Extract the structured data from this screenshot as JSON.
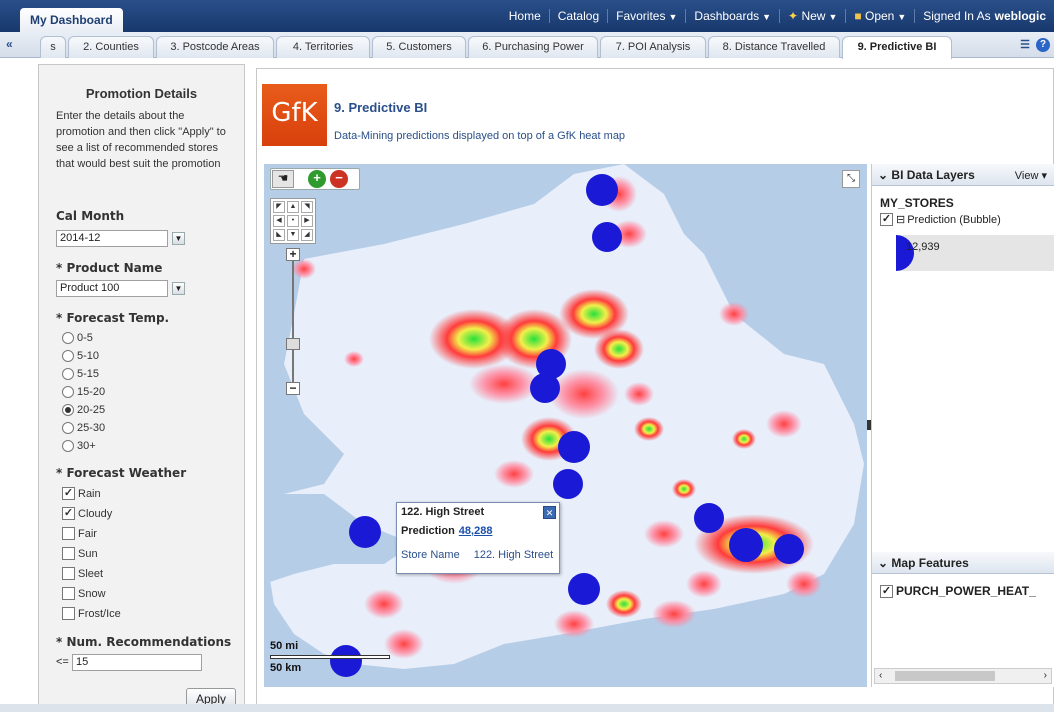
{
  "app": {
    "dashboard_tab": "My Dashboard",
    "nav": {
      "home": "Home",
      "catalog": "Catalog",
      "favorites": "Favorites",
      "dashboards": "Dashboards",
      "new": "New",
      "open": "Open",
      "signed_in_as": "Signed In As",
      "user": "weblogic"
    }
  },
  "tabs": [
    {
      "label": "s"
    },
    {
      "label": "2. Counties"
    },
    {
      "label": "3. Postcode Areas"
    },
    {
      "label": "4. Territories"
    },
    {
      "label": "5. Customers"
    },
    {
      "label": "6. Purchasing Power"
    },
    {
      "label": "7. POI Analysis"
    },
    {
      "label": "8. Distance Travelled"
    },
    {
      "label": "9. Predictive BI",
      "active": true
    }
  ],
  "promotion": {
    "title": "Promotion Details",
    "intro": "Enter the details about the promotion and then click \"Apply\" to see a list of recommended stores that would best suit the promotion",
    "cal_month_label": "Cal Month",
    "cal_month_value": "2014-12",
    "product_label": "* Product Name",
    "product_value": "Product 100",
    "temp_label": "* Forecast Temp.",
    "temp_options": [
      "0-5",
      "5-10",
      "5-15",
      "15-20",
      "20-25",
      "25-30",
      "30+"
    ],
    "temp_selected": "20-25",
    "weather_label": "* Forecast Weather",
    "weather_options": [
      {
        "label": "Rain",
        "checked": true
      },
      {
        "label": "Cloudy",
        "checked": true
      },
      {
        "label": "Fair",
        "checked": false
      },
      {
        "label": "Sun",
        "checked": false
      },
      {
        "label": "Sleet",
        "checked": false
      },
      {
        "label": "Snow",
        "checked": false
      },
      {
        "label": "Frost/Ice",
        "checked": false
      }
    ],
    "num_label": "* Num. Recommendations",
    "num_op": "<=",
    "num_value": "15",
    "apply_label": "Apply"
  },
  "report": {
    "logo_text": "GfK",
    "title": "9. Predictive BI",
    "subtitle": "Data-Mining predictions displayed on top of a GfK heat map"
  },
  "map": {
    "scale_mi": "50 mi",
    "scale_km": "50 km",
    "store_color": "#1a1ad6"
  },
  "popup": {
    "title": "122. High Street",
    "prediction_label": "Prediction",
    "prediction_value": "48,288",
    "store_name_label": "Store Name",
    "store_name_value": "122. High Street"
  },
  "layers": {
    "header": "BI Data Layers",
    "view_label": "View",
    "group": "MY_STORES",
    "layer_name": "Prediction (Bubble)",
    "legend_value": "12,939",
    "map_features_header": "Map Features",
    "feature_name": "PURCH_POWER_HEAT_"
  }
}
